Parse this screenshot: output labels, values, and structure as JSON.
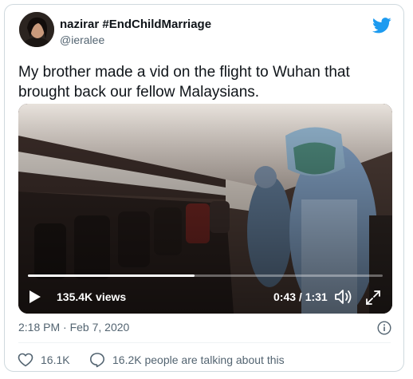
{
  "author": {
    "display_name": "nazirar #EndChildMarriage",
    "handle": "@ieralee",
    "avatar_icon": "profile-photo"
  },
  "tweet": {
    "text": "My brother made a vid on the flight to Wuhan that brought back our fellow Malaysians.",
    "timestamp": "2:18 PM · Feb 7, 2020"
  },
  "video": {
    "views": "135.4K views",
    "time": "0:43 / 1:31",
    "progress": 0.47
  },
  "footer": {
    "likes": "16.1K",
    "talking": "16.2K people are talking about this"
  },
  "colors": {
    "brand": "#1d9bf0",
    "text_secondary": "#536471",
    "border": "#cfd9de"
  },
  "icons": {
    "brand": "twitter-bird-icon",
    "play": "play-icon",
    "volume": "volume-icon",
    "fullscreen": "fullscreen-icon",
    "info": "info-icon",
    "like": "heart-icon",
    "reply": "speech-bubble-icon"
  }
}
